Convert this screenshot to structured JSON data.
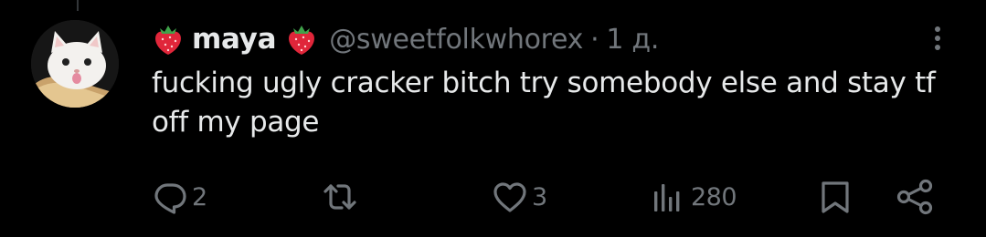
{
  "tweet": {
    "display_name": "maya",
    "handle": "@sweetfolkwhorex",
    "separator": "·",
    "time": "1 д.",
    "text": "fucking ugly cracker bitch try somebody else and stay tf off my page"
  },
  "actions": {
    "replies": "2",
    "reposts": "",
    "likes": "3",
    "views": "280"
  },
  "icons": {
    "name_emoji": "strawberry-icon",
    "more": "more-vertical-icon",
    "reply": "reply-icon",
    "repost": "repost-icon",
    "like": "heart-icon",
    "views": "analytics-icon",
    "bookmark": "bookmark-icon",
    "share": "share-icon"
  },
  "colors": {
    "background": "#000000",
    "primary_text": "#e7e9ea",
    "secondary_text": "#71767b",
    "strawberry": "#e0263a"
  }
}
